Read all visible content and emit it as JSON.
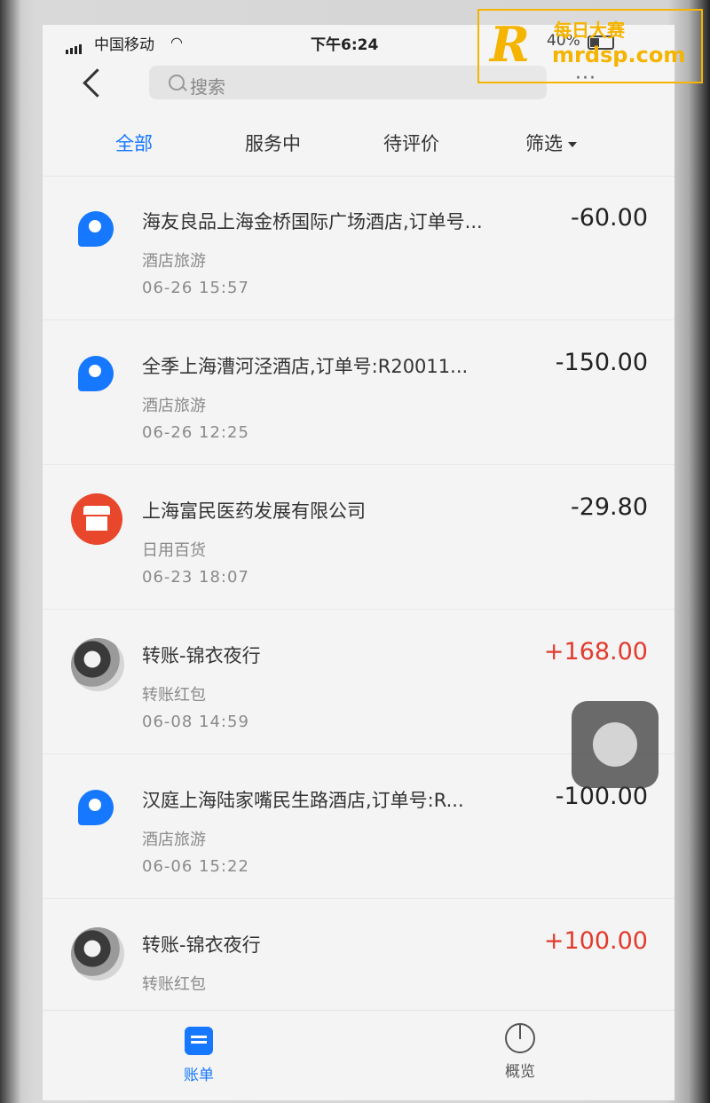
{
  "status_bar": {
    "carrier": "中国移动",
    "time": "下午6:24",
    "battery": "40%"
  },
  "nav": {
    "search_placeholder": "搜索",
    "more": "···"
  },
  "tabs": [
    {
      "label": "全部",
      "active": true
    },
    {
      "label": "服务中",
      "active": false
    },
    {
      "label": "待评价",
      "active": false
    },
    {
      "label": "筛选",
      "active": false
    }
  ],
  "transactions": [
    {
      "icon": "alipay-p-icon",
      "title": "海友良品上海金桥国际广场酒店,订单号...",
      "amount": "-60.00",
      "category": "酒店旅游",
      "time": "06-26  15:57"
    },
    {
      "icon": "alipay-p-icon",
      "title": "全季上海漕河泾酒店,订单号:R20011...",
      "amount": "-150.00",
      "category": "酒店旅游",
      "time": "06-26  12:25"
    },
    {
      "icon": "shop-icon",
      "title": "上海富民医药发展有限公司",
      "amount": "-29.80",
      "category": "日用百货",
      "time": "06-23  18:07"
    },
    {
      "icon": "avatar",
      "title": "转账-锦衣夜行",
      "amount": "+168.00",
      "category": "转账红包",
      "time": "06-08  14:59"
    },
    {
      "icon": "alipay-p-icon",
      "title": "汉庭上海陆家嘴民生路酒店,订单号:R...",
      "amount": "-100.00",
      "category": "酒店旅游",
      "time": "06-06  15:22"
    },
    {
      "icon": "avatar",
      "title": "转账-锦衣夜行",
      "amount": "+100.00",
      "category": "转账红包",
      "time": ""
    }
  ],
  "tab_bar": {
    "bill": "账单",
    "overview": "概览"
  },
  "watermark": {
    "logo": "R",
    "name": "每日大赛",
    "url": "mrdsp.com"
  },
  "colors": {
    "accent": "#1677ff",
    "income": "#e23a2e",
    "shop": "#e8472c"
  }
}
